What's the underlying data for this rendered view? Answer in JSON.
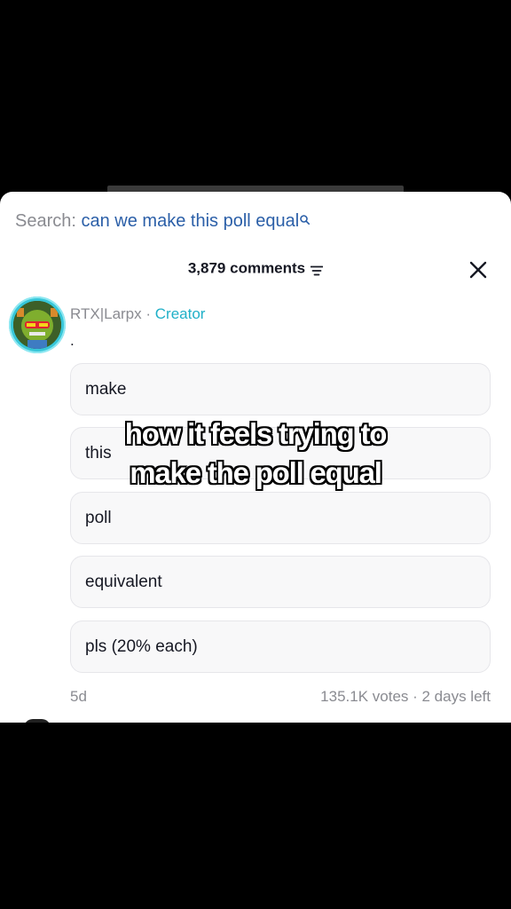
{
  "search": {
    "prefix": "Search:",
    "query": "can we make this poll equal"
  },
  "comments": {
    "count_label": "3,879 comments"
  },
  "comment": {
    "author": "RTX|Larpx",
    "separator": "·",
    "badge": "Creator",
    "text": ".",
    "time": "5d",
    "poll_meta": "135.1K votes · 2 days left"
  },
  "poll": {
    "options": [
      {
        "label": "make"
      },
      {
        "label": "this"
      },
      {
        "label": "poll"
      },
      {
        "label": "equivalent"
      },
      {
        "label": "pls (20% each)"
      }
    ]
  },
  "caption": {
    "line1": "how it feels trying to",
    "line2": "make the poll equal"
  },
  "colors": {
    "link_blue": "#2b5fa8",
    "creator_teal": "#20b0c8",
    "muted_gray": "#8a8b91"
  }
}
